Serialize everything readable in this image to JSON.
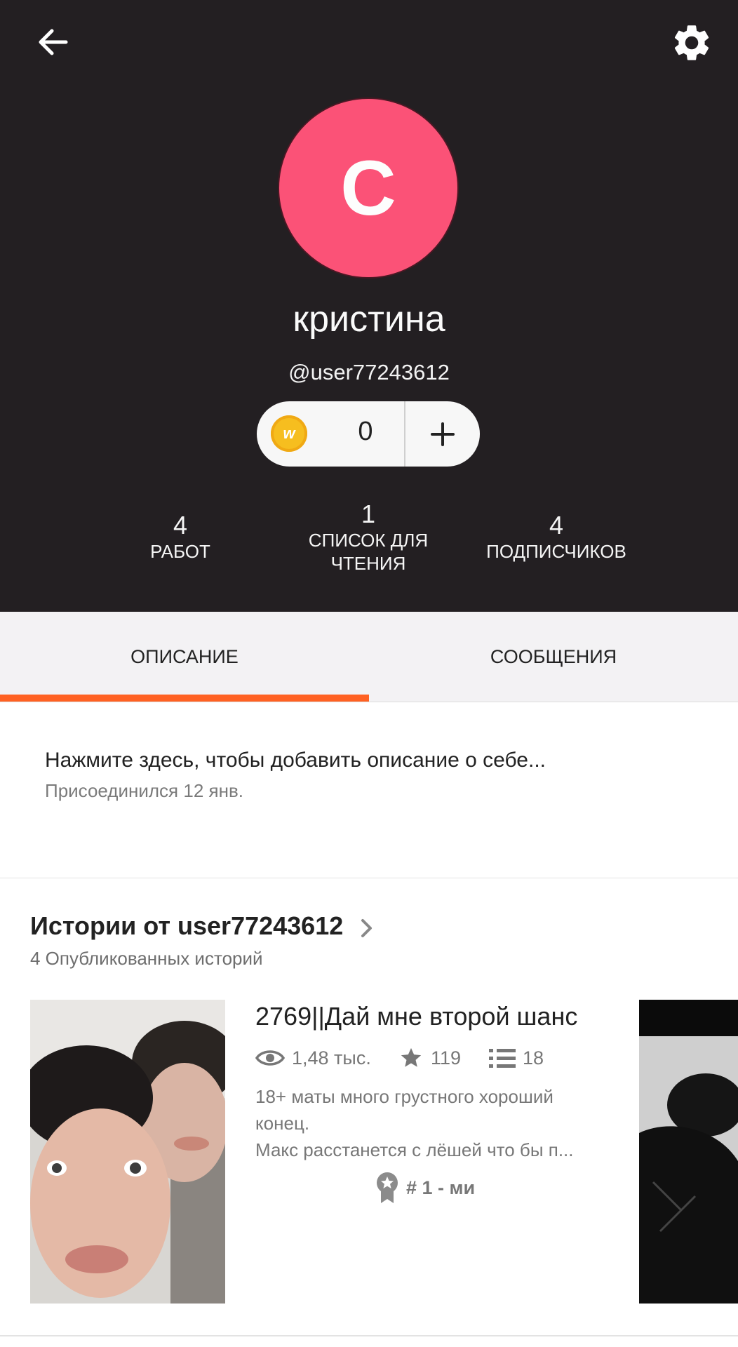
{
  "profile": {
    "avatar_letter": "С",
    "name": "кристина",
    "handle": "@user77243612",
    "coins": "0",
    "avatar_color": "#fb5277"
  },
  "stats": [
    {
      "value": "4",
      "label": "РАБОТ"
    },
    {
      "value": "1",
      "label_line1": "СПИСОК ДЛЯ",
      "label_line2": "ЧТЕНИЯ"
    },
    {
      "value": "4",
      "label": "ПОДПИСЧИКОВ"
    }
  ],
  "tabs": [
    {
      "label": "ОПИСАНИЕ",
      "active": true
    },
    {
      "label": "СООБЩЕНИЯ",
      "active": false
    }
  ],
  "about": {
    "prompt": "Нажмите здесь, чтобы добавить описание о себе...",
    "joined": "Присоединился 12 янв."
  },
  "stories": {
    "title": "Истории от user77243612",
    "count": "4 Опубликованных историй",
    "items": [
      {
        "title": "2769||Дай мне второй шанс",
        "reads": "1,48 тыс.",
        "votes": "119",
        "parts": "18",
        "summary_line1": "18+ маты много грустного хороший",
        "summary_line2": "конец.",
        "summary_line3": "Макс расстанется с лёшей что бы п...",
        "rank": "# 1 - ми"
      }
    ]
  },
  "colors": {
    "header_bg": "#231f22",
    "accent": "#ff6122",
    "coin": "#f6be1f"
  },
  "icons": [
    "back-arrow-icon",
    "gear-icon",
    "coin-icon",
    "plus-icon",
    "chevron-right-icon",
    "eye-icon",
    "star-icon",
    "list-icon",
    "ribbon-icon"
  ]
}
